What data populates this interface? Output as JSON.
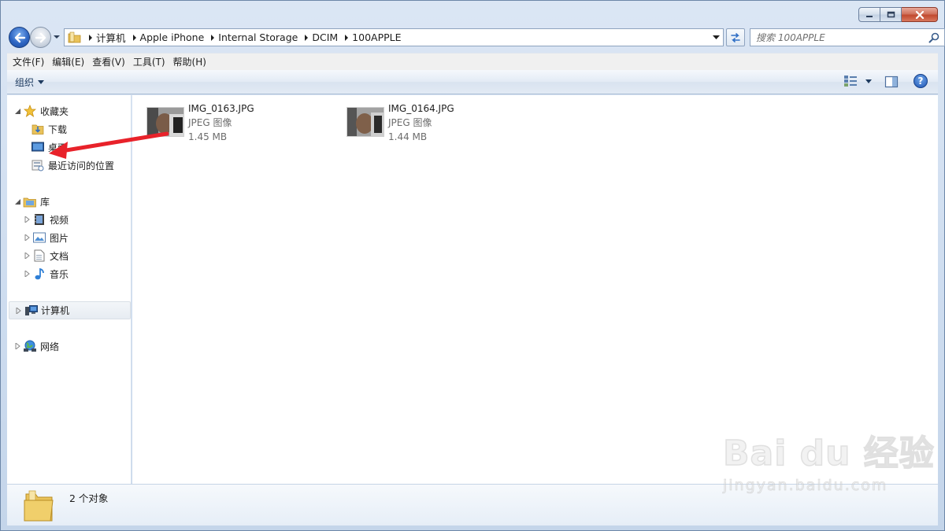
{
  "window": {
    "controls": {
      "minimize": "minimize",
      "maximize": "maximize",
      "close": "close"
    }
  },
  "address_bar": {
    "crumbs": [
      "计算机",
      "Apple iPhone",
      "Internal Storage",
      "DCIM",
      "100APPLE"
    ]
  },
  "search": {
    "placeholder": "搜索 100APPLE"
  },
  "menu": {
    "items": [
      "文件(F)",
      "编辑(E)",
      "查看(V)",
      "工具(T)",
      "帮助(H)"
    ]
  },
  "toolbar": {
    "organize_label": "组织"
  },
  "nav_pane": {
    "favorites": {
      "label": "收藏夹",
      "items": [
        "下载",
        "桌面",
        "最近访问的位置"
      ]
    },
    "libraries": {
      "label": "库",
      "items": [
        "视频",
        "图片",
        "文档",
        "音乐"
      ]
    },
    "computer": {
      "label": "计算机"
    },
    "network": {
      "label": "网络"
    }
  },
  "files": [
    {
      "name": "IMG_0163.JPG",
      "type": "JPEG 图像",
      "size": "1.45 MB"
    },
    {
      "name": "IMG_0164.JPG",
      "type": "JPEG 图像",
      "size": "1.44 MB"
    }
  ],
  "status": {
    "count_text": "2 个对象"
  },
  "watermark": {
    "brand": "Bai du 经验",
    "url": "jingyan.baidu.com"
  },
  "colors": {
    "annotation_arrow": "#e8222a",
    "window_frame": "#c9d9ec",
    "selection": "#e7ecf2"
  }
}
